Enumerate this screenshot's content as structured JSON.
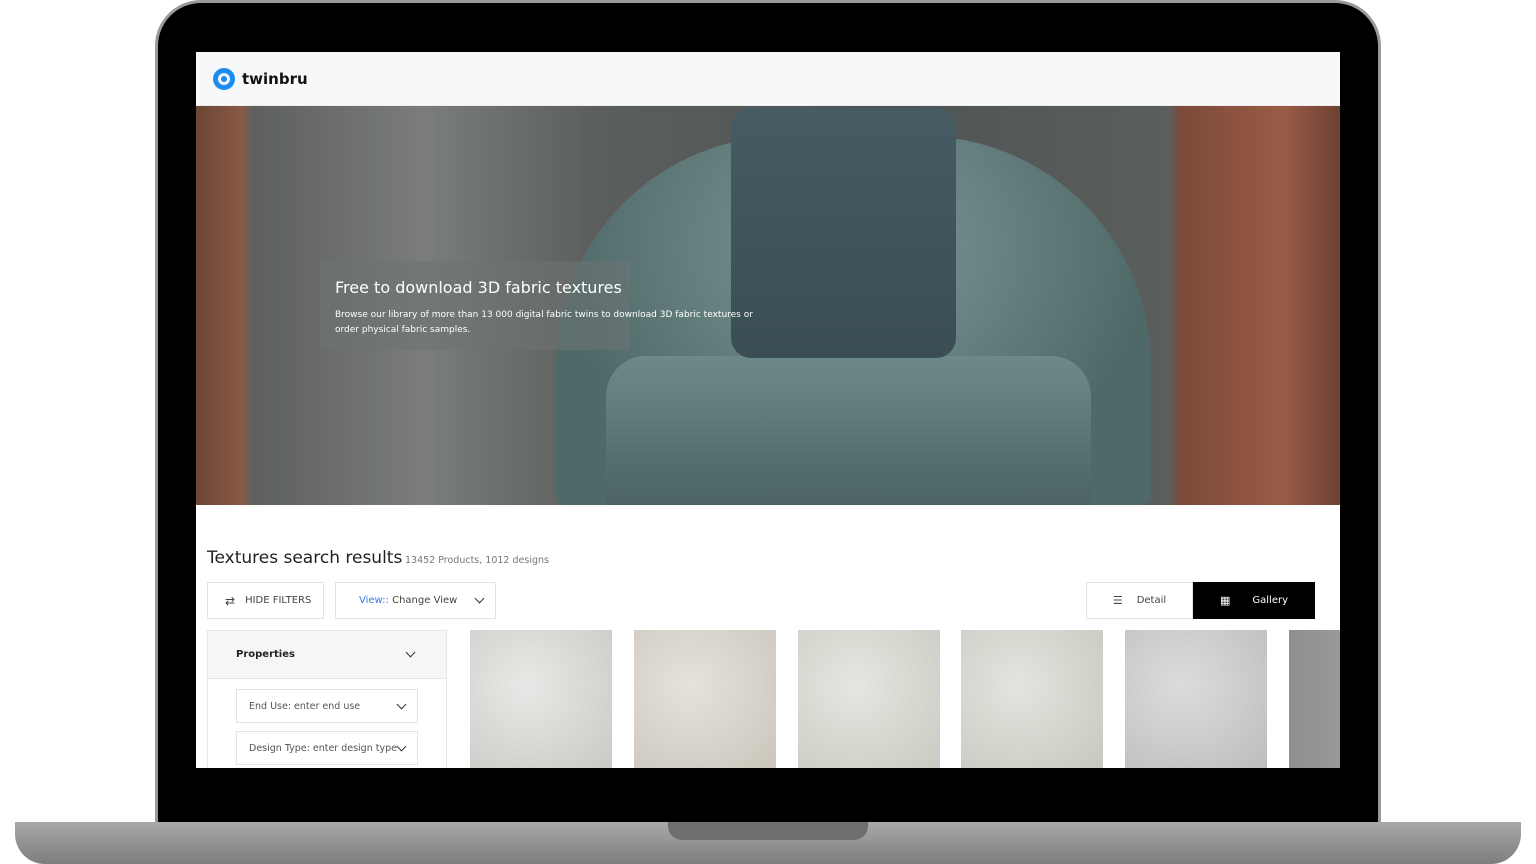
{
  "app": {
    "logo": "twinbru"
  },
  "hero": {
    "title": "Free to download 3D fabric textures",
    "subtitle": "Browse our library of more than 13 000 digital fabric twins to download 3D fabric textures or order physical fabric samples."
  },
  "results": {
    "title": "Textures search results",
    "count": "13452 Products, 1012 designs"
  },
  "toolbar": {
    "hide_filters": "HIDE FILTERS",
    "view_prefix": "View::",
    "view_value": "Change View",
    "detail": "Detail",
    "gallery": "Gallery",
    "active_view": "Gallery"
  },
  "filters": {
    "section": "Properties",
    "fields": [
      "End Use: enter end use",
      "Design Type: enter design type"
    ]
  },
  "tiles": [
    {
      "color": "#dcdcda"
    },
    {
      "color": "#d8d4cc"
    },
    {
      "color": "#d9d9d4"
    },
    {
      "color": "#d7d7d2"
    },
    {
      "color": "#cfcfcf"
    },
    {
      "color": "#9a9a9a"
    }
  ],
  "colors": {
    "accent": "#1a8cf0",
    "link": "#2f7cf6"
  }
}
